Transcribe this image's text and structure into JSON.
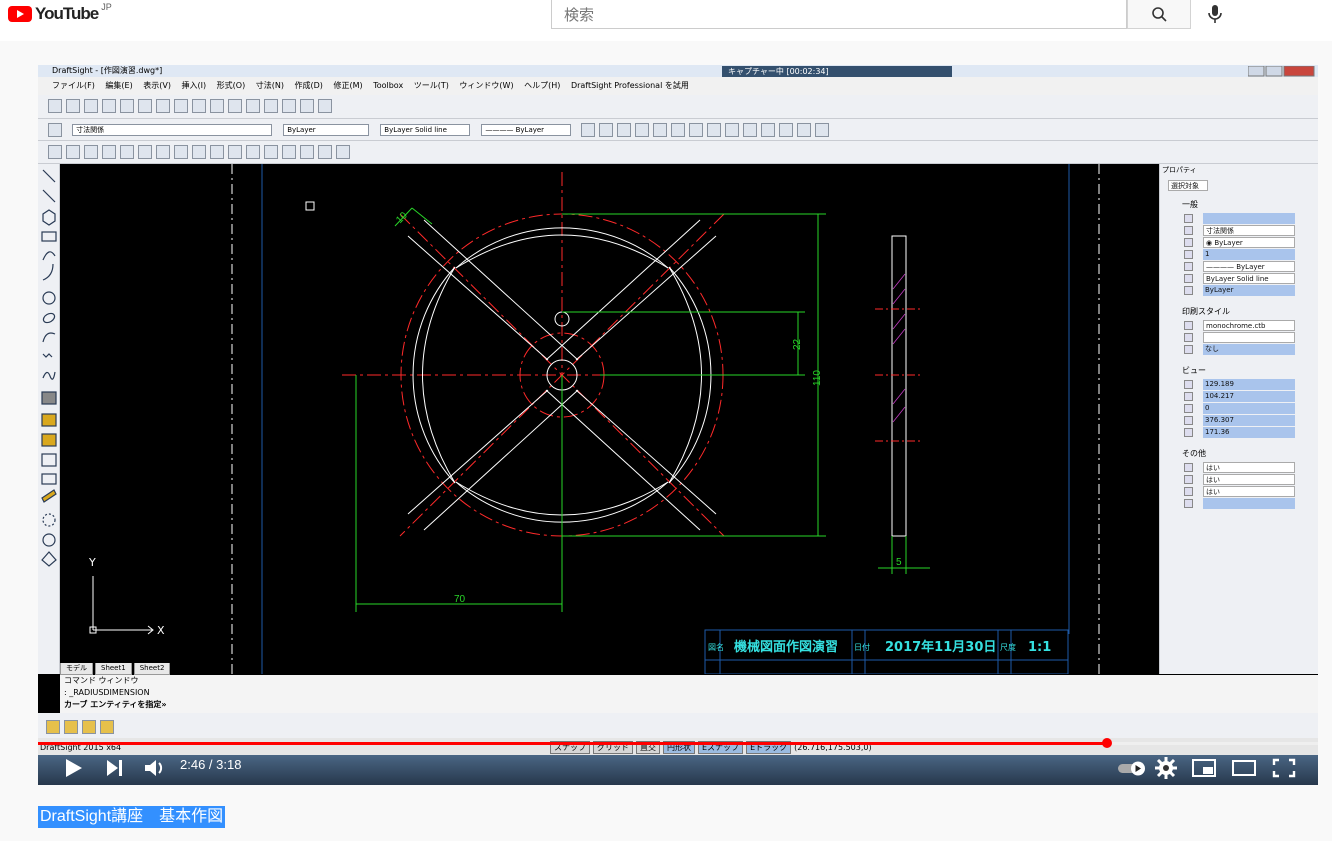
{
  "header": {
    "logo_text": "YouTube",
    "logo_region": "JP",
    "search_placeholder": "検索"
  },
  "draftsight": {
    "window_title": "DraftSight - [作図演習.dwg*]",
    "capture_status": "キャプチャー中 [00:02:34]",
    "menu": [
      "ファイル(F)",
      "編集(E)",
      "表示(V)",
      "挿入(I)",
      "形式(O)",
      "寸法(N)",
      "作成(D)",
      "修正(M)",
      "Toolbox",
      "ツール(T)",
      "ウィンドウ(W)",
      "ヘルプ(H)",
      "DraftSight Professional を試用"
    ],
    "layer_combo": "寸法関係",
    "color_combo": "ByLayer",
    "linetype_combo": "ByLayer    Solid line",
    "lineweight_combo": "———— ByLayer",
    "tabs": [
      "モデル",
      "Sheet1",
      "Sheet2"
    ],
    "drawing": {
      "dim_width": "10",
      "dim_hole": "22",
      "dim_height": "110",
      "dim_radius": "70",
      "dim_thickness": "5",
      "axis_y": "Y",
      "axis_x": "X",
      "tb_label_name": "図名",
      "tb_title": "機械図面作図演習",
      "tb_label_date": "日付",
      "tb_date": "2017年11月30日",
      "tb_label_scale": "尺度",
      "tb_scale": "1:1"
    },
    "properties": {
      "title": "プロパティ",
      "selector": "選択対象",
      "sec_general": "一般",
      "general": [
        "",
        "寸法関係",
        "◉ ByLayer",
        "1",
        "———— ByLayer",
        "ByLayer    Solid line",
        "ByLayer"
      ],
      "sec_print": "印刷スタイル",
      "print": [
        "monochrome.ctb",
        "",
        "なし"
      ],
      "sec_view": "ビュー",
      "view": [
        "129.189",
        "104.217",
        "0",
        "376.307",
        "171.36"
      ],
      "sec_other": "その他",
      "other": [
        "はい",
        "はい",
        "はい",
        ""
      ]
    },
    "command": {
      "title": "コマンド ウィンドウ",
      "line1": ": _RADIUSDIMENSION",
      "line2": "カーブ エンティティを指定»"
    },
    "status": {
      "app": "DraftSight 2015 x64",
      "buttons": [
        "スナップ",
        "グリッド",
        "直交",
        "円形状",
        "Eスナップ",
        "Eトラック"
      ],
      "buttons_on": [
        false,
        false,
        false,
        true,
        true,
        true
      ],
      "coords": "(26.716,175.503,0)"
    }
  },
  "player": {
    "current_time": "2:46",
    "duration": "3:18",
    "progress": 0.838
  },
  "video": {
    "title": "DraftSight講座　基本作図"
  }
}
